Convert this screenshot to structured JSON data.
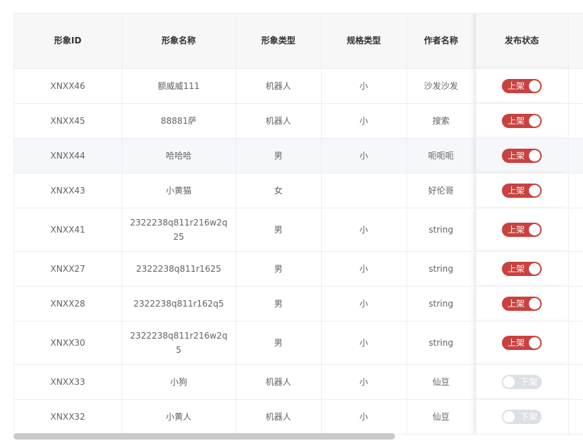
{
  "table": {
    "headers": [
      "形象ID",
      "形象名称",
      "形象类型",
      "规格类型",
      "作者名称",
      "发布状态"
    ],
    "rows": [
      {
        "id": "XNXX46",
        "name": "额威威111",
        "type": "机器人",
        "spec": "小",
        "author": "沙发沙发",
        "status": "上架",
        "on": true
      },
      {
        "id": "XNXX45",
        "name": "88881萨",
        "type": "机器人",
        "spec": "小",
        "author": "搜索",
        "status": "上架",
        "on": true
      },
      {
        "id": "XNXX44",
        "name": "哈哈哈",
        "type": "男",
        "spec": "小",
        "author": "呃呃呃",
        "status": "上架",
        "on": true
      },
      {
        "id": "XNXX43",
        "name": "小黄猫",
        "type": "女",
        "spec": "",
        "author": "好伦哥",
        "status": "上架",
        "on": true
      },
      {
        "id": "XNXX41",
        "name": "2322238q811r216w2q25",
        "type": "男",
        "spec": "小",
        "author": "string",
        "status": "上架",
        "on": true
      },
      {
        "id": "XNXX27",
        "name": "2322238q811r1625",
        "type": "男",
        "spec": "小",
        "author": "string",
        "status": "上架",
        "on": true
      },
      {
        "id": "XNXX28",
        "name": "2322238q811r162q5",
        "type": "男",
        "spec": "小",
        "author": "string",
        "status": "上架",
        "on": true
      },
      {
        "id": "XNXX30",
        "name": "2322238q811r216w2q5",
        "type": "男",
        "spec": "小",
        "author": "string",
        "status": "上架",
        "on": true
      },
      {
        "id": "XNXX33",
        "name": "小狗",
        "type": "机器人",
        "spec": "小",
        "author": "仙豆",
        "status": "下架",
        "on": false
      },
      {
        "id": "XNXX32",
        "name": "小黄人",
        "type": "机器人",
        "spec": "小",
        "author": "仙豆",
        "status": "下架",
        "on": false
      }
    ]
  },
  "colors": {
    "switch_on": "#c9423f",
    "switch_off": "#dcdfe6",
    "header_bg": "#f7f7f7",
    "border": "#ebeef5"
  }
}
